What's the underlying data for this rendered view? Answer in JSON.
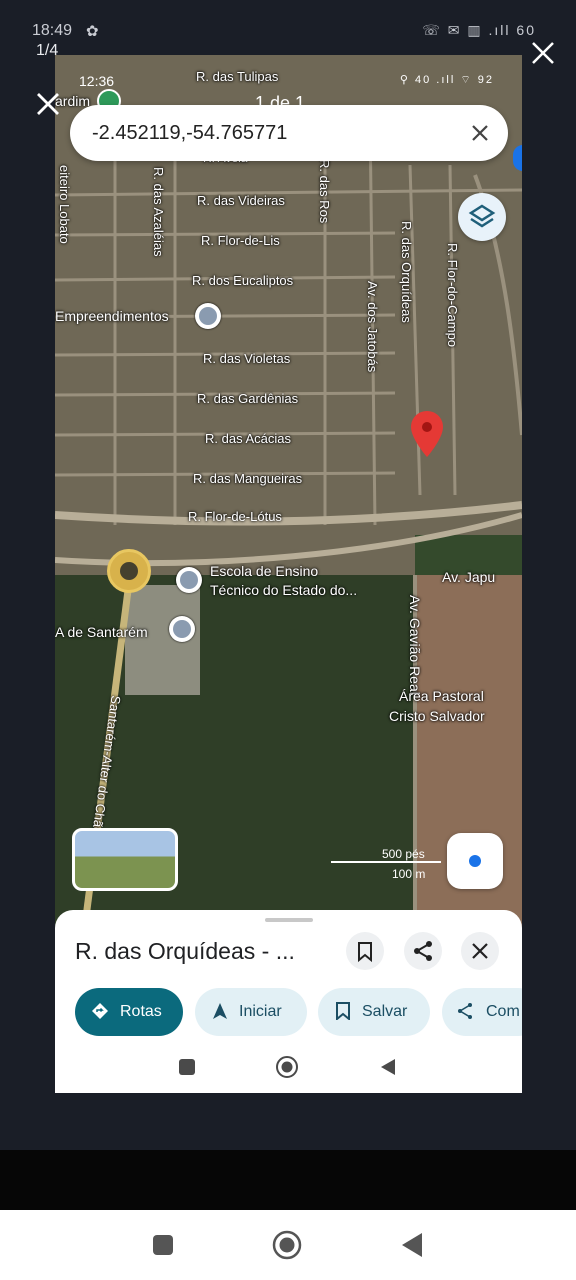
{
  "outer_status": {
    "time": "18:49",
    "icons": "☏ ✉ ▥ .ıll 60"
  },
  "viewer": {
    "page_counter": "1/4"
  },
  "inner_status": {
    "time": "12:36",
    "icons": "⚲ 40 .ıll ⌔ 92"
  },
  "map_header": {
    "result_count": "1 de 1"
  },
  "search": {
    "value": "-2.452119,-54.765771"
  },
  "streets": {
    "tulipas": "R. das Tulipas",
    "azaleias": "R. das Azaléias",
    "videiras": "R. das Videiras",
    "rosas": "R. das Ros",
    "flor_de_lis": "R. Flor-de-Lis",
    "eucaliptos": "R. dos Eucaliptos",
    "orquideas": "R. das Orquídeas",
    "flor_do_campo": "R. Flor-do-Campo",
    "jatobas": "Av. dos Jatobás",
    "violetas": "R. das Violetas",
    "gardenias": "R. das Gardênias",
    "acacias": "R. das Acácias",
    "mangueiras": "R. das Mangueiras",
    "flor_de_lotus": "R. Flor-de-Lótus",
    "japu": "Av. Japu",
    "gaviao_real": "Av. Gavião Real",
    "alter_do_chao": "Santarém-Alter do Chão",
    "lobato": "eiteiro Lobato",
    "aveia": "R. Aveia"
  },
  "pois": {
    "jardim": "ardim",
    "empreendimentos": "Empreendimentos",
    "escola_line1": "Escola de Ensino",
    "escola_line2": "Técnico do Estado do...",
    "santarem": "A de Santarém",
    "area_pastoral_line1": "Área Pastoral",
    "area_pastoral_line2": "Cristo Salvador"
  },
  "scale": {
    "imperial": "500 pés",
    "metric": "100 m"
  },
  "place_sheet": {
    "title": "R. das Orquídeas - ...",
    "actions": {
      "rotas": "Rotas",
      "iniciar": "Iniciar",
      "salvar": "Salvar",
      "compartilhar": "Com"
    }
  },
  "colors": {
    "accent": "#0b6a7d",
    "pin": "#e53935",
    "location": "#1a73e8"
  },
  "icons": [
    "close-icon",
    "layers-icon",
    "bookmark-icon",
    "share-icon",
    "navigation-icon",
    "directions-icon",
    "location-pin-icon",
    "my-location-icon"
  ]
}
